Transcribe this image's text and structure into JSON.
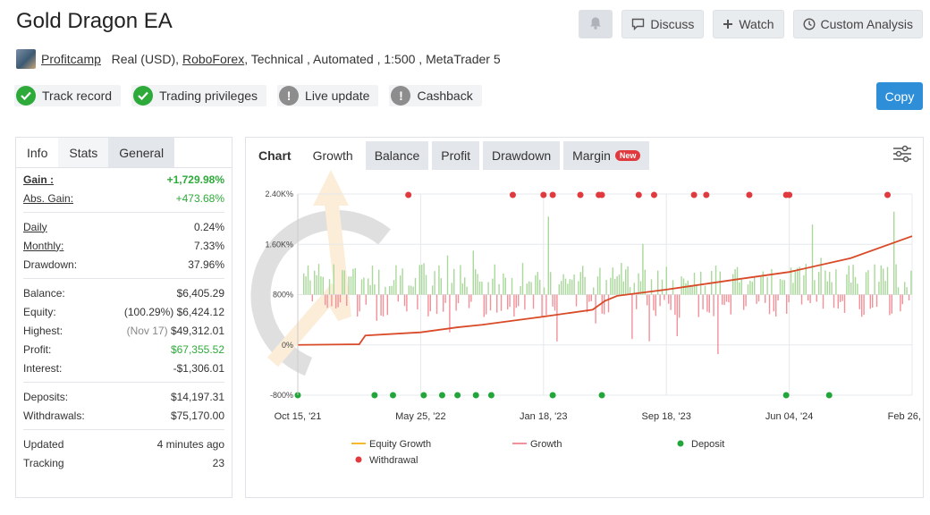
{
  "title": "Gold Dragon EA",
  "top_buttons": {
    "discuss": "Discuss",
    "watch": "Watch",
    "custom_analysis": "Custom Analysis"
  },
  "subline": {
    "author": "Profitcamp",
    "account": "Real (USD),",
    "broker": "RoboForex",
    "details": ", Technical , Automated , 1:500 , MetaTrader 5"
  },
  "badges": [
    "Track record",
    "Trading privileges",
    "Live update",
    "Cashback"
  ],
  "copy_button": "Copy",
  "left_tabs": [
    "Info",
    "Stats",
    "General"
  ],
  "stats": {
    "gain_label": "Gain :",
    "gain_value": "+1,729.98%",
    "abs_gain_label": "Abs. Gain:",
    "abs_gain_value": "+473.68%",
    "daily_label": "Daily",
    "daily_value": "0.24%",
    "monthly_label": "Monthly:",
    "monthly_value": "7.33%",
    "drawdown_label": "Drawdown:",
    "drawdown_value": "37.96%",
    "balance_label": "Balance:",
    "balance_value": "$6,405.29",
    "equity_label": "Equity:",
    "equity_pct": "(100.29%)",
    "equity_value": "$6,424.12",
    "highest_label": "Highest:",
    "highest_date": "(Nov 17)",
    "highest_value": "$49,312.01",
    "profit_label": "Profit:",
    "profit_value": "$67,355.52",
    "interest_label": "Interest:",
    "interest_value": "-$1,306.01",
    "deposits_label": "Deposits:",
    "deposits_value": "$14,197.31",
    "withdrawals_label": "Withdrawals:",
    "withdrawals_value": "$75,170.00",
    "updated_label": "Updated",
    "updated_value": "4 minutes ago",
    "tracking_label": "Tracking",
    "tracking_value": "23"
  },
  "chart_tabs": {
    "chart": "Chart",
    "growth": "Growth",
    "balance": "Balance",
    "profit": "Profit",
    "drawdown": "Drawdown",
    "margin": "Margin",
    "new_tag": "New"
  },
  "colors": {
    "equity": "#f5b92e",
    "growth_line": "#d94a28",
    "bar_pos": "#a8d89a",
    "bar_neg": "#f2919a",
    "deposit": "#22a63a",
    "withdrawal": "#e0393e"
  },
  "chart_data": {
    "type": "line",
    "y_ticks": [
      "2.40K%",
      "1.60K%",
      "800%",
      "0%",
      "-800%"
    ],
    "x_ticks": [
      "Oct 15, '21",
      "May 25, '22",
      "Jan 18, '23",
      "Sep 18, '23",
      "Jun 04, '24",
      "Feb 26, '25"
    ],
    "ylim": [
      -800,
      2400
    ],
    "legend": [
      "Equity Growth",
      "Growth",
      "Deposit",
      "Withdrawal"
    ],
    "growth": [
      [
        0.0,
        0
      ],
      [
        0.1,
        10
      ],
      [
        0.11,
        150
      ],
      [
        0.2,
        200
      ],
      [
        0.26,
        280
      ],
      [
        0.3,
        320
      ],
      [
        0.4,
        450
      ],
      [
        0.48,
        560
      ],
      [
        0.5,
        700
      ],
      [
        0.52,
        780
      ],
      [
        0.6,
        880
      ],
      [
        0.72,
        1050
      ],
      [
        0.8,
        1160
      ],
      [
        0.9,
        1380
      ],
      [
        1.0,
        1730
      ]
    ],
    "withdrawals_x": [
      0.18,
      0.35,
      0.4,
      0.415,
      0.46,
      0.49,
      0.495,
      0.555,
      0.58,
      0.645,
      0.665,
      0.735,
      0.795,
      0.8,
      0.96
    ],
    "deposits_x": [
      0.0,
      0.125,
      0.155,
      0.205,
      0.235,
      0.26,
      0.29,
      0.315,
      0.415,
      0.495,
      0.795,
      0.865
    ]
  }
}
